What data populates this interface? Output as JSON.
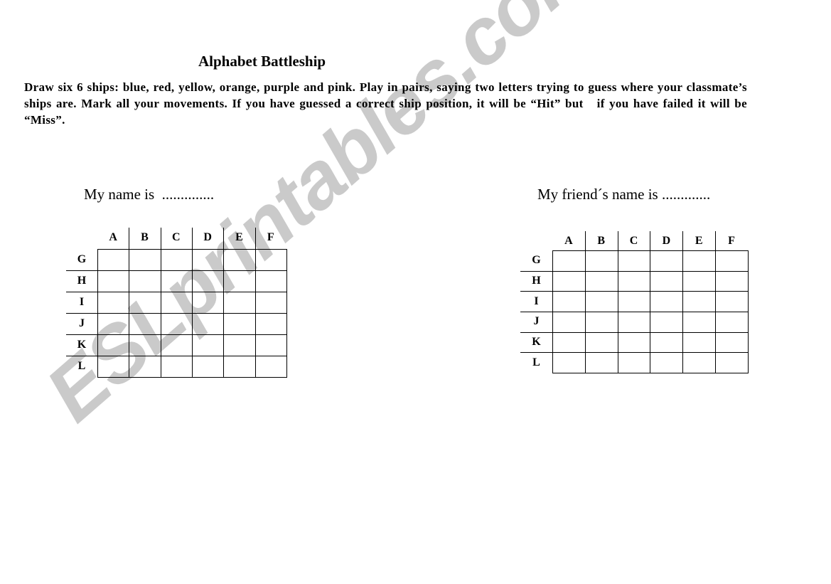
{
  "document": {
    "title": "Alphabet Battleship",
    "instructions": "Draw six 6 ships: blue, red, yellow, orange, purple and pink. Play in pairs, saying two letters trying to guess where your classmate’s ships are. Mark all your movements. If you have guessed a correct ship position, it will be “Hit” but   if you have failed it will be “Miss”.",
    "ship_colors": [
      "blue",
      "red",
      "yellow",
      "orange",
      "purple",
      "pink"
    ]
  },
  "boards": [
    {
      "id": "my-board",
      "label": "My name is  ..............",
      "columns": [
        "A",
        "B",
        "C",
        "D",
        "E",
        "F"
      ],
      "rows": [
        "G",
        "H",
        "I",
        "J",
        "K",
        "L"
      ]
    },
    {
      "id": "friend-board",
      "label": "My friend´s name is .............",
      "columns": [
        "A",
        "B",
        "C",
        "D",
        "E",
        "F"
      ],
      "rows": [
        "G",
        "H",
        "I",
        "J",
        "K",
        "L"
      ]
    }
  ],
  "watermark": {
    "text": "ESLprintables.com",
    "color": "#cacaca"
  }
}
